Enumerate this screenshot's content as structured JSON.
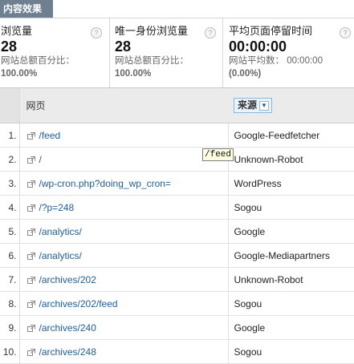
{
  "tab": {
    "label": "内容效果"
  },
  "metrics": [
    {
      "title": "浏览量",
      "value": "28",
      "sub_label": "网站总额百分比：",
      "sub_value": "100.00%"
    },
    {
      "title": "唯一身份浏览量",
      "value": "28",
      "sub_label": "网站总额百分比：",
      "sub_value": "100.00%"
    },
    {
      "title": "平均页面停留时间",
      "value": "00:00:00",
      "sub_label": "网站平均数：  00:00:00",
      "sub_value": "(0.00%)"
    }
  ],
  "help_icon": "?",
  "table": {
    "col_page": "网页",
    "col_source": "来源",
    "rows": [
      {
        "num": "1.",
        "page": "/feed",
        "source": "Google-Feedfetcher"
      },
      {
        "num": "2.",
        "page": "/",
        "source": "Unknown-Robot"
      },
      {
        "num": "3.",
        "page": "/wp-cron.php?doing_wp_cron=",
        "source": "WordPress"
      },
      {
        "num": "4.",
        "page": "/?p=248",
        "source": "Sogou"
      },
      {
        "num": "5.",
        "page": "/analytics/",
        "source": "Google"
      },
      {
        "num": "6.",
        "page": "/analytics/",
        "source": "Google-Mediapartners"
      },
      {
        "num": "7.",
        "page": "/archives/202",
        "source": "Unknown-Robot"
      },
      {
        "num": "8.",
        "page": "/archives/202/feed",
        "source": "Sogou"
      },
      {
        "num": "9.",
        "page": "/archives/240",
        "source": "Google"
      },
      {
        "num": "10.",
        "page": "/archives/248",
        "source": "Sogou"
      }
    ]
  },
  "tooltip": {
    "text": "/feed"
  },
  "colors": {
    "tab_bg": "#6e7f90",
    "link": "#1f5d99",
    "tooltip_bg": "#ffffe1"
  },
  "icons": {
    "row_link": "external-link-icon",
    "source_toggle": "chevron-down-icon"
  }
}
